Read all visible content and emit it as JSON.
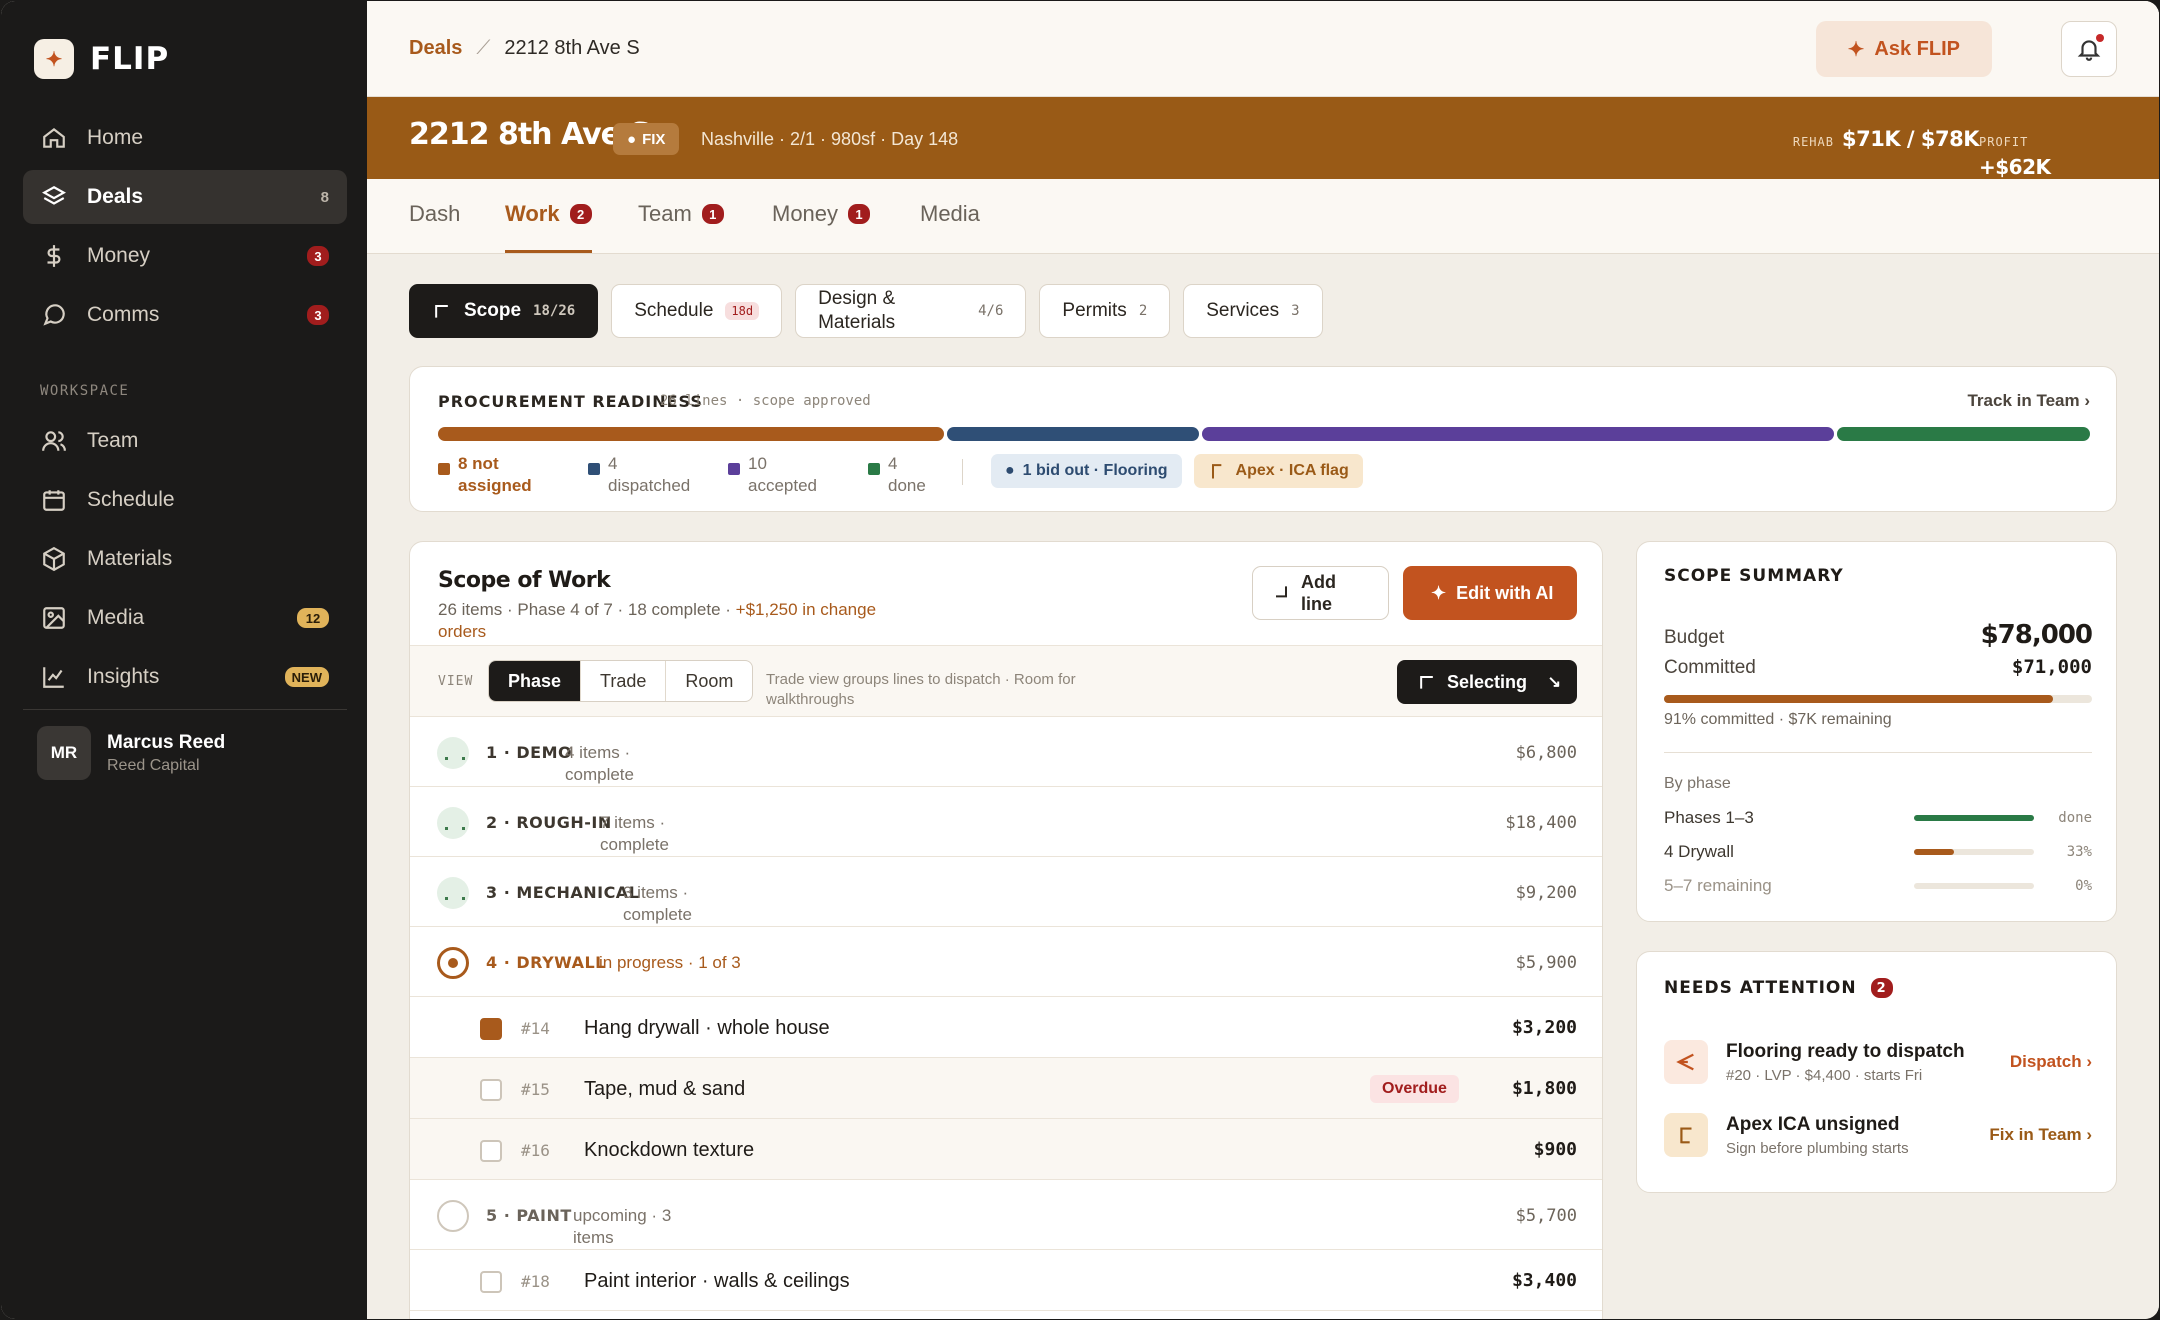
{
  "brand": {
    "logo_glyph": "✦",
    "name": "FLIP"
  },
  "sidebar": {
    "items": [
      {
        "label": "Home",
        "icon": "home-icon",
        "count": ""
      },
      {
        "label": "Deals",
        "icon": "layers-icon",
        "count": "8"
      },
      {
        "label": "Money",
        "icon": "dollar-icon",
        "count": "3"
      },
      {
        "label": "Comms",
        "icon": "chat-icon",
        "count": "3"
      }
    ],
    "workspace_label": "WORKSPACE",
    "workspace_items": [
      {
        "label": "Team",
        "icon": "users-icon",
        "count": ""
      },
      {
        "label": "Schedule",
        "icon": "calendar-icon",
        "count": ""
      },
      {
        "label": "Materials",
        "icon": "box-icon",
        "count": ""
      },
      {
        "label": "Media",
        "icon": "image-icon",
        "count": "12"
      },
      {
        "label": "Insights",
        "icon": "chart-line-icon",
        "count": "NEW"
      }
    ],
    "user": {
      "initials": "MR",
      "name": "Marcus Reed",
      "org": "Reed Capital"
    }
  },
  "topbar": {
    "crumb_root": "Deals",
    "crumb_current": "2212 8th Ave S",
    "ask_label": "Ask FLIP"
  },
  "hero": {
    "title": "2212 8th Ave S",
    "tag": "FIX",
    "meta": "Nashville · 2/1 · 980sf · Day 148",
    "rehab_label": "REHAB",
    "rehab_value": "$71K / $78K",
    "profit_label": "PROFIT",
    "profit_value": "+$62K"
  },
  "tabs": [
    {
      "label": "Dash",
      "badge": ""
    },
    {
      "label": "Work",
      "badge": "2"
    },
    {
      "label": "Team",
      "badge": "1"
    },
    {
      "label": "Money",
      "badge": "1"
    },
    {
      "label": "Media",
      "badge": ""
    }
  ],
  "subtabs": {
    "scope": {
      "label": "Scope",
      "count": "18/26"
    },
    "schedule": {
      "label": "Schedule",
      "pill": "18d"
    },
    "design": {
      "label": "Design & Materials",
      "count": "4/6"
    },
    "permits": {
      "label": "Permits",
      "count": "2"
    },
    "services": {
      "label": "Services",
      "count": "3"
    }
  },
  "procurement": {
    "title": "PROCUREMENT READINESS",
    "sub": "26 lines · scope approved",
    "link": "Track in Team ›",
    "segments": [
      {
        "label": "not assigned",
        "count": 8,
        "color": "#a85a1c"
      },
      {
        "label": "dispatched",
        "count": 4,
        "color": "#2f4f76"
      },
      {
        "label": "accepted",
        "count": 10,
        "color": "#5b3f9a"
      },
      {
        "label": "done",
        "count": 4,
        "color": "#2a7a46"
      }
    ],
    "legend": [
      "8 not assigned",
      "4 dispatched",
      "10 accepted",
      "4 done"
    ],
    "chip_bid": "1 bid out · Flooring",
    "chip_flag": "Apex · ICA flag"
  },
  "scope": {
    "title": "Scope of Work",
    "sub_main": "26 items · Phase 4 of 7 · 18 complete · ",
    "sub_change": "+$1,250 in change orders",
    "add_label": "Add line",
    "ai_label": "Edit with AI",
    "view_label": "VIEW",
    "views": [
      "Phase",
      "Trade",
      "Room"
    ],
    "view_hint": "Trade view groups lines to dispatch · Room for walkthroughs",
    "selecting_label": "Selecting",
    "phases": [
      {
        "name": "1 · DEMO",
        "status": "4 items · complete",
        "amount": "$6,800"
      },
      {
        "name": "2 · ROUGH-IN",
        "status": "7 items · complete",
        "amount": "$18,400"
      },
      {
        "name": "3 · MECHANICAL",
        "status": "3 items · complete",
        "amount": "$9,200"
      },
      {
        "name": "4 · DRYWALL",
        "status": "in progress · 1 of 3",
        "amount": "$5,900"
      },
      {
        "name": "5 · PAINT",
        "status": "upcoming · 3 items",
        "amount": "$5,700"
      }
    ],
    "drywall_items": [
      {
        "num": "#14",
        "name": "Hang drywall · whole house",
        "amount": "$3,200",
        "flag": ""
      },
      {
        "num": "#15",
        "name": "Tape, mud & sand",
        "amount": "$1,800",
        "flag": "Overdue"
      },
      {
        "num": "#16",
        "name": "Knockdown texture",
        "amount": "$900",
        "flag": ""
      }
    ],
    "paint_items": [
      {
        "num": "#18",
        "name": "Paint interior · walls & ceilings",
        "amount": "$3,400"
      }
    ]
  },
  "summary": {
    "title": "SCOPE SUMMARY",
    "budget_label": "Budget",
    "budget_value": "$78,000",
    "committed_label": "Committed",
    "committed_value": "$71,000",
    "committed_fraction": 0.91,
    "note": "91% committed · $7K remaining",
    "by_phase_label": "By phase",
    "phases": [
      {
        "name": "Phases 1–3",
        "pct": "done",
        "fill": 1.0,
        "color": "#2a7a46"
      },
      {
        "name": "4 Drywall",
        "pct": "33%",
        "fill": 0.33,
        "color": "#a85a1c"
      },
      {
        "name": "5–7 remaining",
        "pct": "0%",
        "fill": 0,
        "color": "#a85a1c"
      }
    ]
  },
  "attention": {
    "title": "NEEDS ATTENTION",
    "count": "2",
    "items": [
      {
        "title": "Flooring ready to dispatch",
        "sub": "#20 · LVP · $4,400 · starts Fri",
        "action": "Dispatch ›",
        "icon": "send-icon",
        "color": "#c2531f",
        "bg": "#fbe9df"
      },
      {
        "title": "Apex ICA unsigned",
        "sub": "Sign before plumbing starts",
        "action": "Fix in Team ›",
        "icon": "flag-icon",
        "color": "#9a5a17",
        "bg": "#f8e7cd"
      }
    ]
  }
}
